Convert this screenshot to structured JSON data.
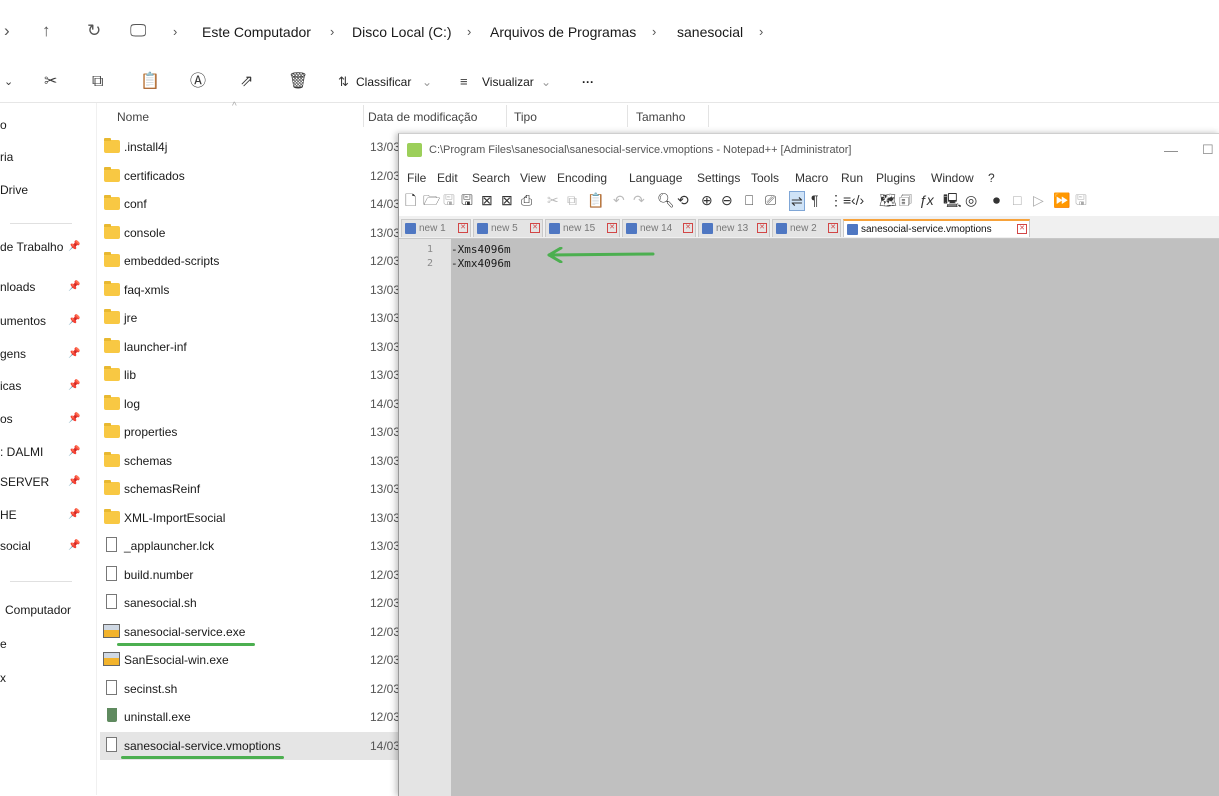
{
  "address_bar": {
    "breadcrumbs": [
      "Este Computador",
      "Disco Local (C:)",
      "Arquivos de Programas",
      "sanesocial"
    ]
  },
  "toolbar": {
    "sort_label": "Classificar",
    "view_label": "Visualizar",
    "more_label": "···"
  },
  "sidebar": {
    "items": [
      {
        "label": "o",
        "pinned": false
      },
      {
        "label": "ria",
        "pinned": false
      },
      {
        "label": "Drive",
        "pinned": false
      },
      {
        "label": "de Trabalho",
        "pinned": true
      },
      {
        "label": "nloads",
        "pinned": true
      },
      {
        "label": "umentos",
        "pinned": true
      },
      {
        "label": "gens",
        "pinned": true
      },
      {
        "label": "icas",
        "pinned": true
      },
      {
        "label": "os",
        "pinned": true
      },
      {
        "label": ": DALMI",
        "pinned": true
      },
      {
        "label": "SERVER",
        "pinned": true
      },
      {
        "label": "HE",
        "pinned": true
      },
      {
        "label": "social",
        "pinned": true
      },
      {
        "label": "Computador",
        "pinned": false
      },
      {
        "label": "e",
        "pinned": false
      },
      {
        "label": "x",
        "pinned": false
      }
    ]
  },
  "columns": {
    "name": "Nome",
    "modified": "Data de modificação",
    "type": "Tipo",
    "size": "Tamanho"
  },
  "files": [
    {
      "name": ".install4j",
      "kind": "folder",
      "date": "13/03"
    },
    {
      "name": "certificados",
      "kind": "folder",
      "date": "12/03"
    },
    {
      "name": "conf",
      "kind": "folder",
      "date": "14/03"
    },
    {
      "name": "console",
      "kind": "folder",
      "date": "13/03"
    },
    {
      "name": "embedded-scripts",
      "kind": "folder",
      "date": "12/03"
    },
    {
      "name": "faq-xmls",
      "kind": "folder",
      "date": "13/03"
    },
    {
      "name": "jre",
      "kind": "folder",
      "date": "13/03"
    },
    {
      "name": "launcher-inf",
      "kind": "folder",
      "date": "13/03"
    },
    {
      "name": "lib",
      "kind": "folder",
      "date": "13/03"
    },
    {
      "name": "log",
      "kind": "folder",
      "date": "14/03"
    },
    {
      "name": "properties",
      "kind": "folder",
      "date": "13/03"
    },
    {
      "name": "schemas",
      "kind": "folder",
      "date": "13/03"
    },
    {
      "name": "schemasReinf",
      "kind": "folder",
      "date": "13/03"
    },
    {
      "name": "XML-ImportEsocial",
      "kind": "folder",
      "date": "13/03"
    },
    {
      "name": "_applauncher.lck",
      "kind": "file",
      "date": "13/03"
    },
    {
      "name": "build.number",
      "kind": "file",
      "date": "12/03"
    },
    {
      "name": "sanesocial.sh",
      "kind": "file",
      "date": "12/03"
    },
    {
      "name": "sanesocial-service.exe",
      "kind": "exe",
      "date": "12/03"
    },
    {
      "name": "SanEsocial-win.exe",
      "kind": "exe",
      "date": "12/03"
    },
    {
      "name": "secinst.sh",
      "kind": "file",
      "date": "12/03"
    },
    {
      "name": "uninstall.exe",
      "kind": "uninstaller",
      "date": "12/03"
    },
    {
      "name": "sanesocial-service.vmoptions",
      "kind": "file",
      "date": "14/03"
    }
  ],
  "notepad": {
    "title": "C:\\Program Files\\sanesocial\\sanesocial-service.vmoptions - Notepad++ [Administrator]",
    "menu": [
      "File",
      "Edit",
      "Search",
      "View",
      "Encoding",
      "Language",
      "Settings",
      "Tools",
      "Macro",
      "Run",
      "Plugins",
      "Window",
      "?"
    ],
    "tabs": [
      "new 1",
      "new 5",
      "new 15",
      "new 14",
      "new 13",
      "new 2",
      "sanesocial-service.vmoptions"
    ],
    "active_tab": 6,
    "lines": [
      "-Xms4096m",
      "-Xmx4096m"
    ],
    "line_numbers": [
      "1",
      "2"
    ]
  },
  "colors": {
    "highlight": "#ffff00",
    "annotation": "#4caf50",
    "folder": "#f8c843"
  }
}
